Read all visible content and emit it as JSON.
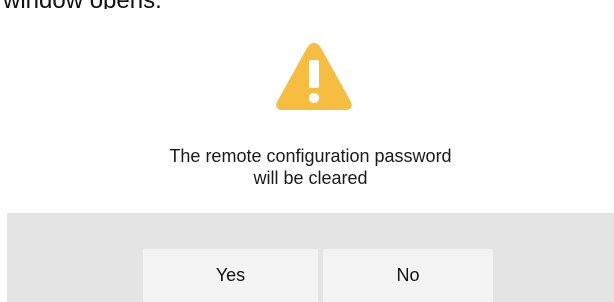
{
  "background_text": "window opens.",
  "dialog": {
    "icon": "warning-triangle-icon",
    "icon_color": "#f6bd41",
    "message_line1": "The remote configuration password",
    "message_line2": "will be cleared",
    "buttons": {
      "yes_label": "Yes",
      "no_label": "No"
    },
    "footer_color": "#e4e4e4"
  }
}
